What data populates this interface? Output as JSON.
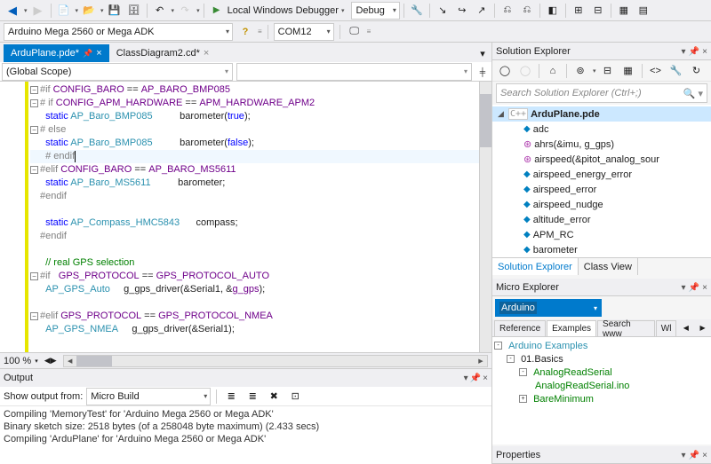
{
  "toolbar": {
    "debugger_label": "Local Windows Debugger",
    "config": "Debug",
    "board": "Arduino Mega 2560 or Mega ADK",
    "port": "COM12"
  },
  "tabs": [
    {
      "label": "ArduPlane.pde*",
      "active": true,
      "pinned": true
    },
    {
      "label": "ClassDiagram2.cd*",
      "active": false,
      "pinned": false
    }
  ],
  "scope": "(Global Scope)",
  "code_lines": [
    {
      "fold": "-",
      "seg": [
        [
          "pp",
          "#if"
        ],
        [
          "",
          ""
        ],
        [
          "macro",
          " CONFIG_BARO"
        ],
        [
          "",
          " == "
        ],
        [
          "macro",
          "AP_BARO_BMP085"
        ]
      ]
    },
    {
      "fold": "-",
      "seg": [
        [
          "pp",
          "# if"
        ],
        [
          "",
          ""
        ],
        [
          "macro",
          " CONFIG_APM_HARDWARE"
        ],
        [
          "",
          " == "
        ],
        [
          "macro",
          "APM_HARDWARE_APM2"
        ]
      ]
    },
    {
      "fold": "",
      "seg": [
        [
          "",
          "  "
        ],
        [
          "blue",
          "static"
        ],
        [
          "",
          ""
        ],
        [
          "type",
          " AP_Baro_BMP085"
        ],
        [
          "",
          "          barometer("
        ],
        [
          "blue",
          "true"
        ],
        [
          "",
          ");"
        ]
      ]
    },
    {
      "fold": "-",
      "seg": [
        [
          "pp",
          "# else"
        ]
      ]
    },
    {
      "fold": "",
      "seg": [
        [
          "",
          "  "
        ],
        [
          "blue",
          "static"
        ],
        [
          "",
          ""
        ],
        [
          "type",
          " AP_Baro_BMP085"
        ],
        [
          "",
          "          barometer("
        ],
        [
          "blue",
          "false"
        ],
        [
          "",
          ");"
        ]
      ]
    },
    {
      "fold": "",
      "cursor": true,
      "seg": [
        [
          "",
          "  "
        ],
        [
          "pp",
          "# endif"
        ]
      ]
    },
    {
      "fold": "-",
      "seg": [
        [
          "pp",
          "#elif"
        ],
        [
          "macro",
          " CONFIG_BARO"
        ],
        [
          "",
          " == "
        ],
        [
          "macro",
          "AP_BARO_MS5611"
        ]
      ]
    },
    {
      "fold": "",
      "seg": [
        [
          "",
          "  "
        ],
        [
          "blue",
          "static"
        ],
        [
          "type",
          " AP_Baro_MS5611"
        ],
        [
          "",
          "          barometer;"
        ]
      ]
    },
    {
      "fold": "",
      "seg": [
        [
          "pp",
          "#endif"
        ]
      ]
    },
    {
      "fold": "",
      "seg": [
        [
          "",
          ""
        ]
      ]
    },
    {
      "fold": "",
      "seg": [
        [
          "",
          "  "
        ],
        [
          "blue",
          "static"
        ],
        [
          "type",
          " AP_Compass_HMC5843"
        ],
        [
          "",
          "      compass;"
        ]
      ]
    },
    {
      "fold": "",
      "seg": [
        [
          "pp",
          "#endif"
        ]
      ]
    },
    {
      "fold": "",
      "seg": [
        [
          "",
          ""
        ]
      ]
    },
    {
      "fold": "",
      "seg": [
        [
          "",
          "  "
        ],
        [
          "comment",
          "// real GPS selection"
        ]
      ]
    },
    {
      "fold": "-",
      "seg": [
        [
          "pp",
          "#if"
        ],
        [
          "",
          "   "
        ],
        [
          "macro",
          "GPS_PROTOCOL"
        ],
        [
          "",
          " == "
        ],
        [
          "macro",
          "GPS_PROTOCOL_AUTO"
        ]
      ]
    },
    {
      "fold": "",
      "seg": [
        [
          "",
          "  "
        ],
        [
          "type",
          "AP_GPS_Auto"
        ],
        [
          "",
          "     g_gps_driver(&Serial1, &"
        ],
        [
          "purple",
          "g_gps"
        ],
        [
          "",
          ");"
        ]
      ]
    },
    {
      "fold": "",
      "seg": [
        [
          "",
          ""
        ]
      ]
    },
    {
      "fold": "-",
      "seg": [
        [
          "pp",
          "#elif"
        ],
        [
          "macro",
          " GPS_PROTOCOL"
        ],
        [
          "",
          " == "
        ],
        [
          "macro",
          "GPS_PROTOCOL_NMEA"
        ]
      ]
    },
    {
      "fold": "",
      "seg": [
        [
          "",
          "  "
        ],
        [
          "type",
          "AP_GPS_NMEA"
        ],
        [
          "",
          "     g_gps_driver(&Serial1);"
        ]
      ]
    }
  ],
  "zoom": "100 %",
  "output": {
    "title": "Output",
    "source_label": "Show output from:",
    "source": "Micro Build",
    "lines": [
      "Compiling 'MemoryTest' for 'Arduino Mega 2560 or Mega ADK'",
      "Binary sketch size: 2518 bytes (of a 258048 byte maximum) (2.433 secs)",
      "Compiling 'ArduPlane' for 'Arduino Mega 2560 or Mega ADK'"
    ]
  },
  "solution_explorer": {
    "title": "Solution Explorer",
    "search_placeholder": "Search Solution Explorer (Ctrl+;)",
    "root": "ArduPlane.pde",
    "items": [
      {
        "icon": "var",
        "label": "adc"
      },
      {
        "icon": "fn",
        "label": "ahrs(&imu, g_gps)"
      },
      {
        "icon": "fn",
        "label": "airspeed(&pitot_analog_sour"
      },
      {
        "icon": "var",
        "label": "airspeed_energy_error"
      },
      {
        "icon": "var",
        "label": "airspeed_error"
      },
      {
        "icon": "var",
        "label": "airspeed_nudge"
      },
      {
        "icon": "var",
        "label": "altitude_error"
      },
      {
        "icon": "var",
        "label": "APM_RC"
      },
      {
        "icon": "var",
        "label": "barometer"
      }
    ],
    "tabs": [
      "Solution Explorer",
      "Class View"
    ]
  },
  "micro_explorer": {
    "title": "Micro Explorer",
    "filter": "Arduino",
    "tabs": [
      "Reference",
      "Examples",
      "Search www",
      "Wl"
    ],
    "active_tab": "Examples",
    "tree": {
      "root": "Arduino Examples",
      "group": "01.Basics",
      "item1": "AnalogReadSerial",
      "item1_file": "AnalogReadSerial.ino",
      "item2": "BareMinimum"
    }
  },
  "properties_title": "Properties"
}
